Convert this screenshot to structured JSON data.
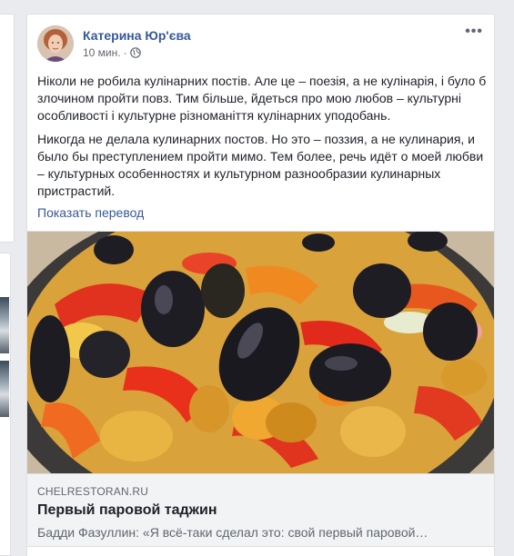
{
  "post": {
    "author": "Катерина Юр'єва",
    "time": "10 мин.",
    "separator": "·",
    "privacy_icon": "globe-icon",
    "more_icon": "more-options-icon",
    "text_uk": "Ніколи не робила кулінарних постів. Але це – поезія, а не кулінарія, і було б злочином пройти повз. Тим більше, йдеться про мою любов – культурні особливості і культурне різноманіття кулінарних уподобань.",
    "text_ru": "Никогда не делала кулинарних постов. Но это – поззия, а не кулинария, и было бы преступлением пройти мимо. Тем более, речь идёт о моей любви – культурных особенностях и культурном разнообразии кулинарных пристрастий.",
    "translate_link": "Показать перевод"
  },
  "link_preview": {
    "domain": "CHELRESTORAN.RU",
    "title": "Первый паровой таджин",
    "description": "Бадди Фазуллин: «Я всё-таки сделал это: свой первый паровой…"
  },
  "colors": {
    "link_blue": "#385898",
    "text": "#1d2129",
    "meta_gray": "#616770",
    "preview_bg": "#f2f3f5"
  }
}
